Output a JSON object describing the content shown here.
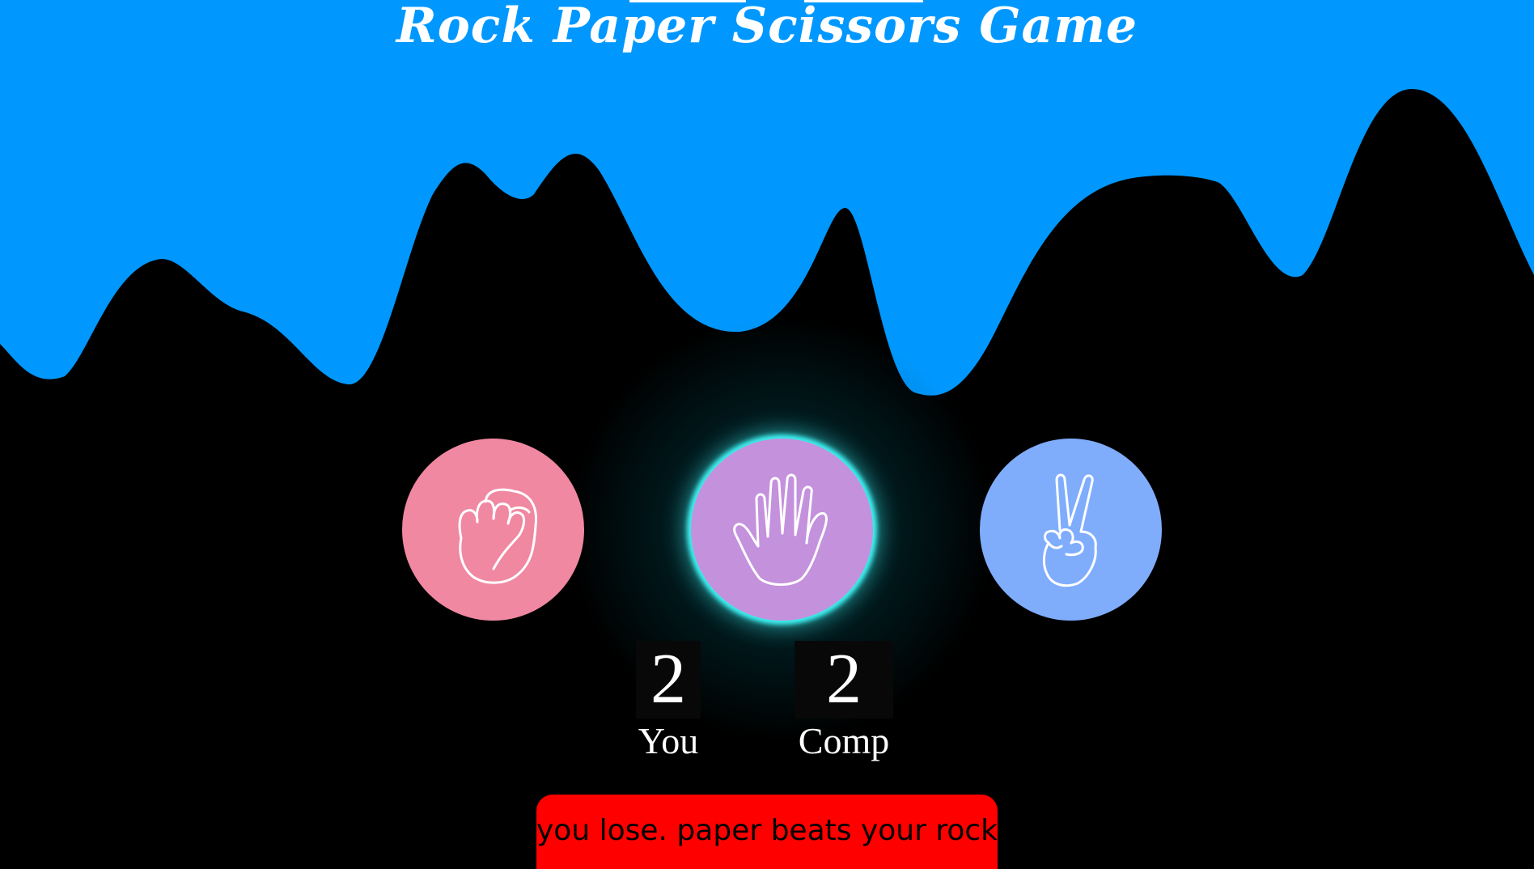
{
  "title": "Rock Paper Scissors Game",
  "colors": {
    "sky": "#0098ff",
    "background": "#000000",
    "rock": "#f088a2",
    "paper": "#c491dd",
    "scissors": "#7fadfc",
    "highlight_glow": "#3ff0f0",
    "result_bg": "#ff0000"
  },
  "choices": [
    {
      "name": "rock",
      "icon": "fist-icon"
    },
    {
      "name": "paper",
      "icon": "open-hand-icon",
      "selected": true
    },
    {
      "name": "scissors",
      "icon": "peace-hand-icon"
    }
  ],
  "score": {
    "user": "2",
    "user_label": "You",
    "comp": "2",
    "comp_label": "Comp"
  },
  "result_message": "you lose. paper beats your rock"
}
